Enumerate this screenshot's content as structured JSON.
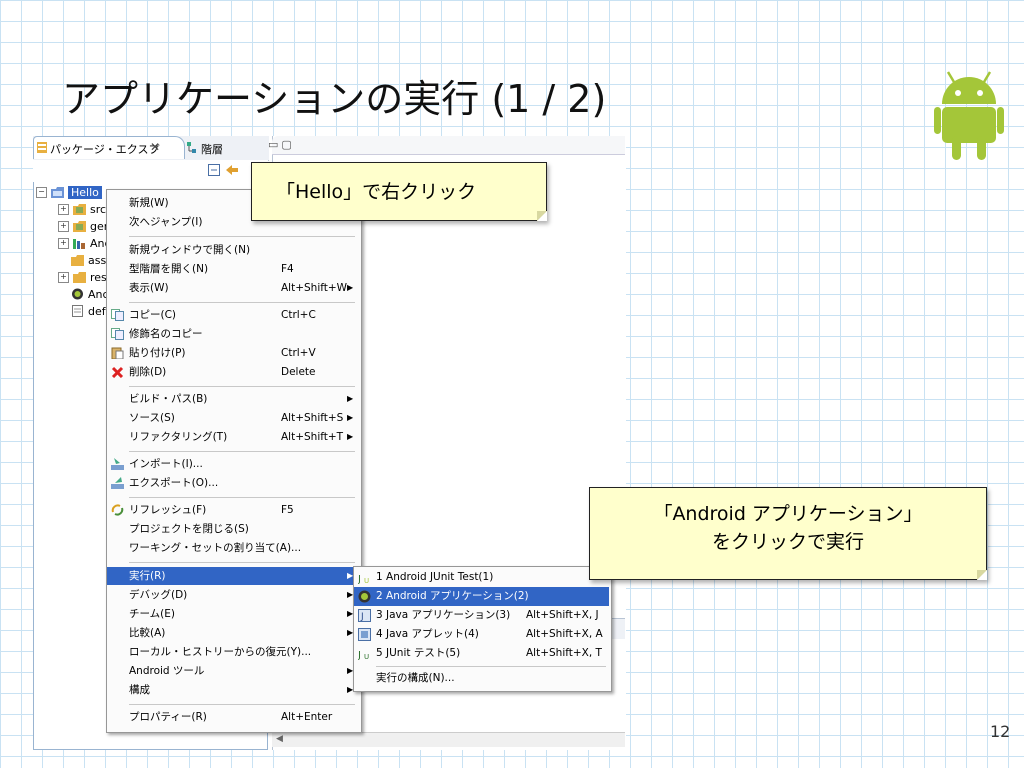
{
  "slide": {
    "title": "アプリケーションの実行 (1 / 2)",
    "page_number": "12"
  },
  "eclipse": {
    "package_tab_label": "パッケージ・エクスプ",
    "hierarchy_tab_label": "階層",
    "tree": [
      {
        "label": "Hello",
        "selected": true
      },
      {
        "label": "src"
      },
      {
        "label": "gen"
      },
      {
        "label": "Anc"
      },
      {
        "label": "ass"
      },
      {
        "label": "res"
      },
      {
        "label": "Anc"
      },
      {
        "label": "def"
      }
    ]
  },
  "context_menu": {
    "items": [
      {
        "label": "新規(W)",
        "shortcut": "",
        "arrow": false
      },
      {
        "label": "次へジャンプ(I)",
        "shortcut": "",
        "arrow": false
      },
      {
        "label": "新規ウィンドウで開く(N)",
        "shortcut": "",
        "arrow": false
      },
      {
        "label": "型階層を開く(N)",
        "shortcut": "F4",
        "arrow": false
      },
      {
        "label": "表示(W)",
        "shortcut": "Alt+Shift+W",
        "arrow": true
      },
      {
        "label": "コピー(C)",
        "shortcut": "Ctrl+C",
        "arrow": false
      },
      {
        "label": "修飾名のコピー",
        "shortcut": "",
        "arrow": false
      },
      {
        "label": "貼り付け(P)",
        "shortcut": "Ctrl+V",
        "arrow": false
      },
      {
        "label": "削除(D)",
        "shortcut": "Delete",
        "arrow": false
      },
      {
        "label": "ビルド・パス(B)",
        "shortcut": "",
        "arrow": true
      },
      {
        "label": "ソース(S)",
        "shortcut": "Alt+Shift+S",
        "arrow": true
      },
      {
        "label": "リファクタリング(T)",
        "shortcut": "Alt+Shift+T",
        "arrow": true
      },
      {
        "label": "インポート(I)...",
        "shortcut": "",
        "arrow": false
      },
      {
        "label": "エクスポート(O)...",
        "shortcut": "",
        "arrow": false
      },
      {
        "label": "リフレッシュ(F)",
        "shortcut": "F5",
        "arrow": false
      },
      {
        "label": "プロジェクトを閉じる(S)",
        "shortcut": "",
        "arrow": false
      },
      {
        "label": "ワーキング・セットの割り当て(A)...",
        "shortcut": "",
        "arrow": false
      },
      {
        "label": "実行(R)",
        "shortcut": "",
        "arrow": true,
        "active": true
      },
      {
        "label": "デバッグ(D)",
        "shortcut": "",
        "arrow": true
      },
      {
        "label": "チーム(E)",
        "shortcut": "",
        "arrow": true
      },
      {
        "label": "比較(A)",
        "shortcut": "",
        "arrow": true
      },
      {
        "label": "ローカル・ヒストリーからの復元(Y)...",
        "shortcut": "",
        "arrow": false
      },
      {
        "label": "Android ツール",
        "shortcut": "",
        "arrow": true
      },
      {
        "label": "構成",
        "shortcut": "",
        "arrow": true
      },
      {
        "label": "プロパティー(R)",
        "shortcut": "Alt+Enter",
        "arrow": false
      }
    ]
  },
  "run_submenu": {
    "items": [
      {
        "label": "1 Android JUnit Test(1)",
        "shortcut": ""
      },
      {
        "label": "2 Android アプリケーション(2)",
        "shortcut": "",
        "active": true
      },
      {
        "label": "3 Java アプリケーション(3)",
        "shortcut": "Alt+Shift+X, J"
      },
      {
        "label": "4 Java アプレット(4)",
        "shortcut": "Alt+Shift+X, A"
      },
      {
        "label": "5 JUnit テスト(5)",
        "shortcut": "Alt+Shift+X, T"
      },
      {
        "label": "実行の構成(N)...",
        "shortcut": ""
      }
    ]
  },
  "callouts": {
    "hello": "「Hello」で右クリック",
    "run_line1": "「Android アプリケーション」",
    "run_line2": "をクリックで実行"
  },
  "colors": {
    "grid": "#c9e2f3",
    "android_green": "#a4c639",
    "selection": "#3165c5",
    "note_bg": "#ffffcc"
  }
}
